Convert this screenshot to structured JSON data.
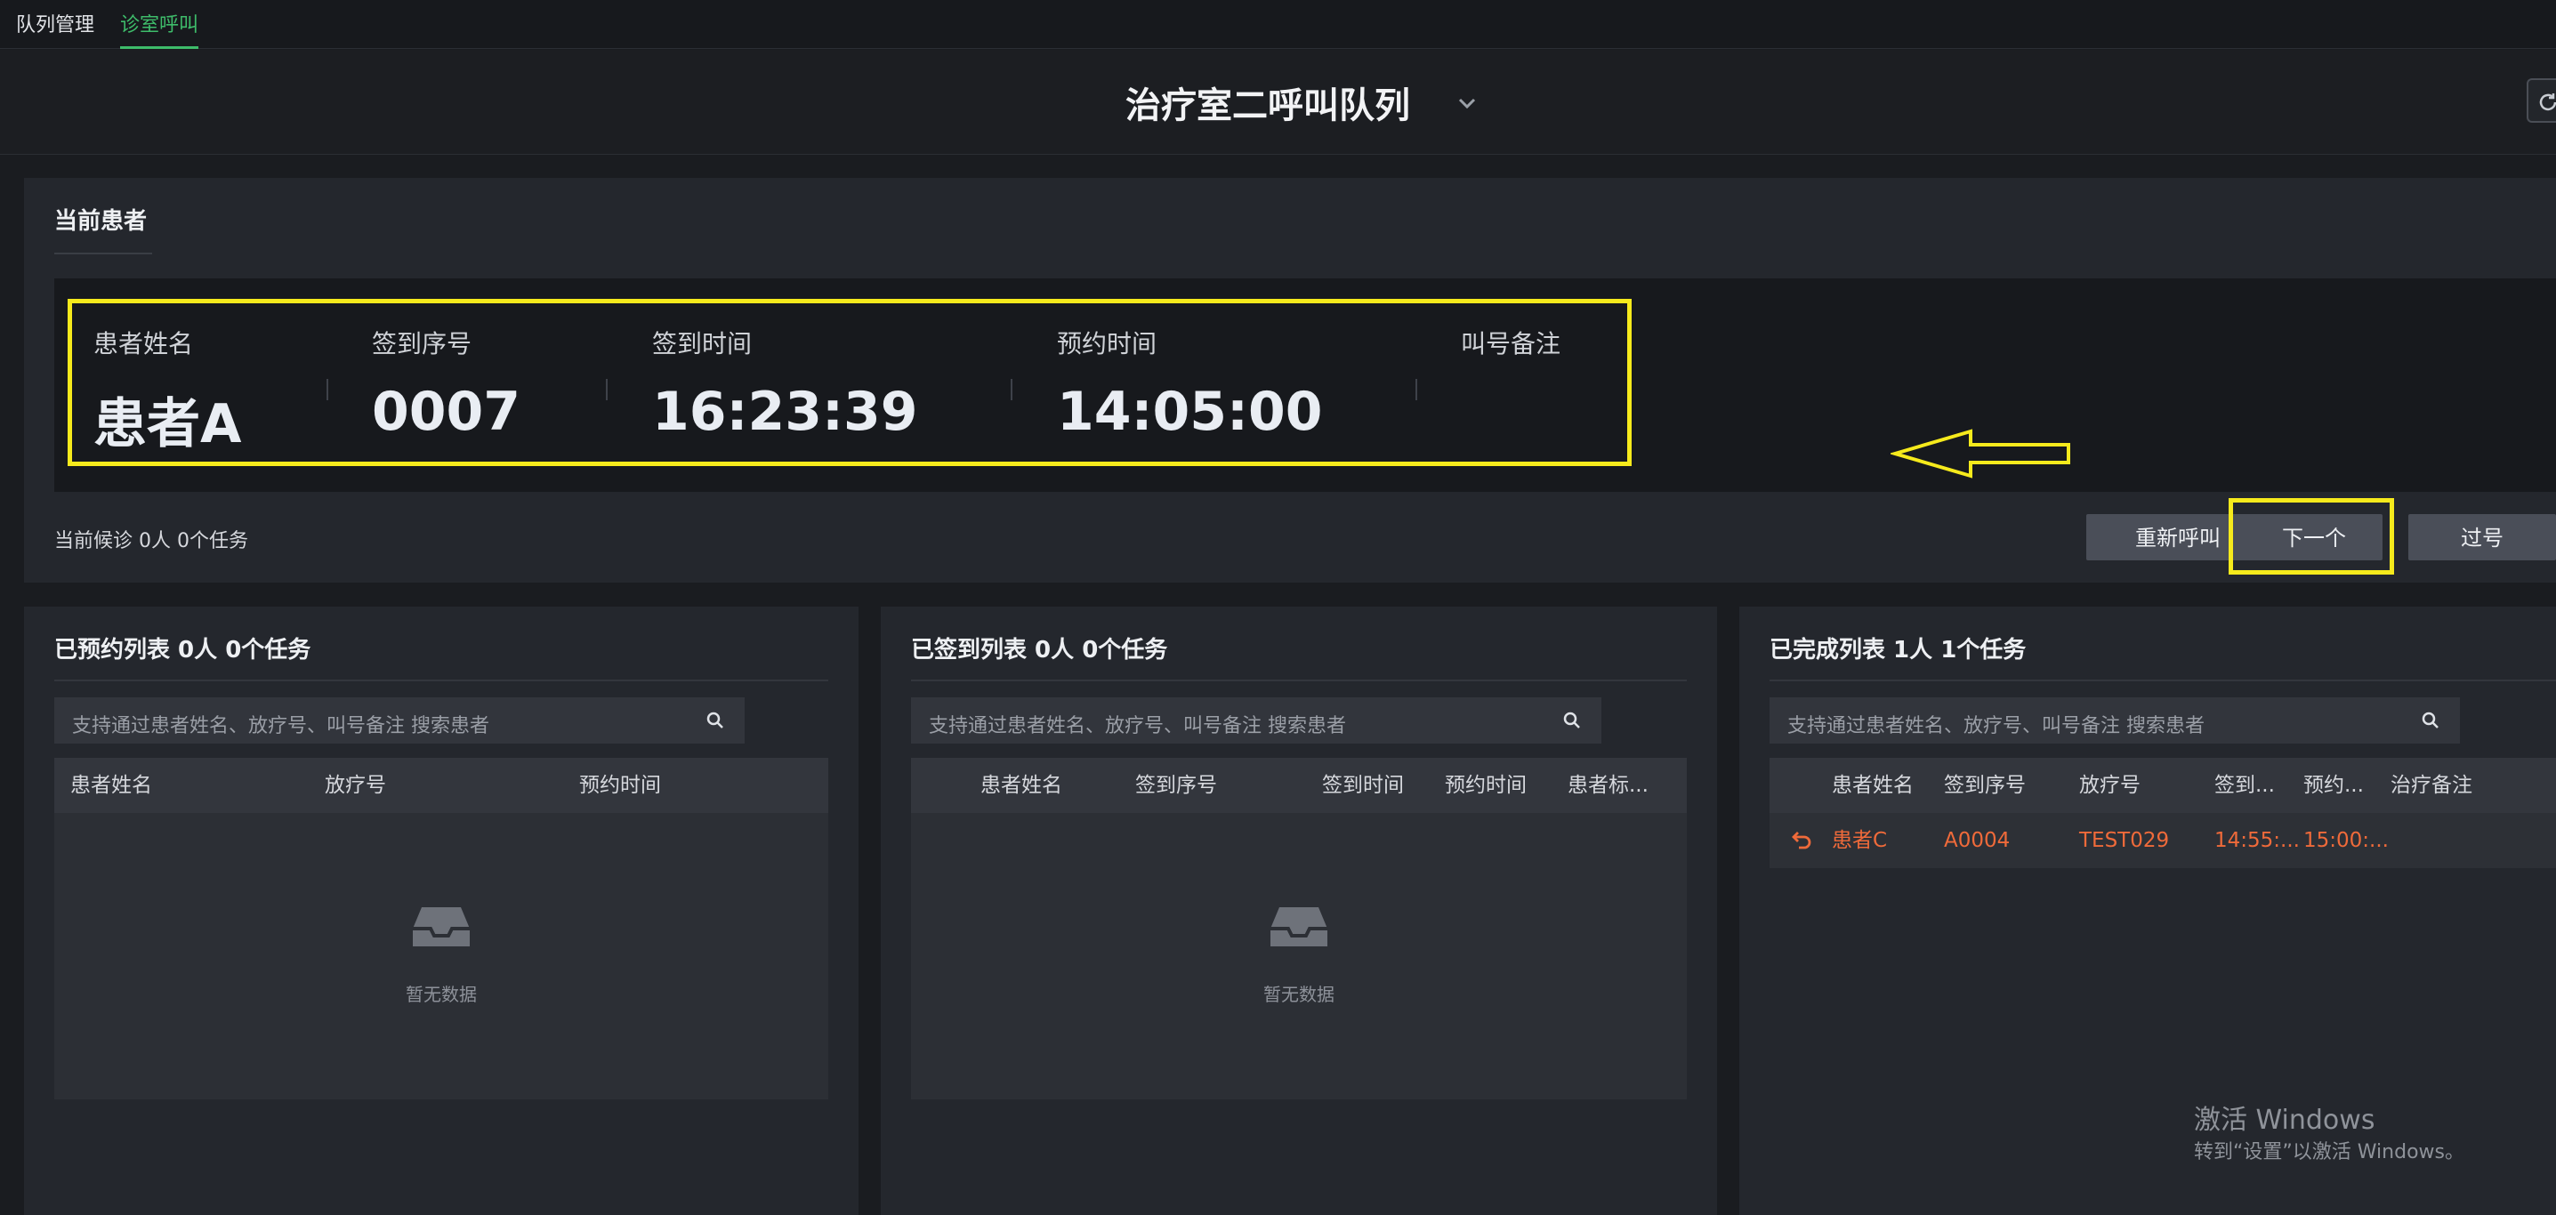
{
  "nav": {
    "tabs": [
      {
        "label": "队列管理"
      },
      {
        "label": "诊室呼叫"
      }
    ],
    "active_color": "#3ebc6a"
  },
  "header": {
    "title": "治疗室二呼叫队列"
  },
  "current_patient": {
    "title": "当前患者",
    "fields": [
      {
        "label": "患者姓名",
        "value": "患者A"
      },
      {
        "label": "签到序号",
        "value": "0007"
      },
      {
        "label": "签到时间",
        "value": "16:23:39"
      },
      {
        "label": "预约时间",
        "value": "14:05:00"
      },
      {
        "label": "叫号备注",
        "value": ""
      }
    ],
    "waiting_text": "当前候诊 0人 0个任务",
    "buttons": {
      "recall": "重新呼叫",
      "next": "下一个",
      "skip": "过号"
    }
  },
  "panels": {
    "reserved": {
      "title": "已预约列表 0人 0个任务",
      "search_placeholder": "支持通过患者姓名、放疗号、叫号备注 搜索患者",
      "columns": [
        "患者姓名",
        "放疗号",
        "预约时间"
      ],
      "empty_text": "暂无数据"
    },
    "checked_in": {
      "title": "已签到列表 0人 0个任务",
      "search_placeholder": "支持通过患者姓名、放疗号、叫号备注 搜索患者",
      "columns": [
        "患者姓名",
        "签到序号",
        "签到时间",
        "预约时间",
        "患者标..."
      ],
      "empty_text": "暂无数据"
    },
    "completed": {
      "title": "已完成列表 1人 1个任务",
      "search_placeholder": "支持通过患者姓名、放疗号、叫号备注 搜索患者",
      "columns": [
        "患者姓名",
        "签到序号",
        "放疗号",
        "签到...",
        "预约...",
        "治疗备注"
      ],
      "rows": [
        {
          "name": "患者C",
          "sign_no": "A0004",
          "rt_no": "TEST029",
          "sign_time": "14:55:...",
          "book_time": "15:00:..."
        }
      ]
    }
  },
  "watermark": {
    "line1": "激活 Windows",
    "line2": "转到“设置”以激活 Windows。"
  },
  "colors": {
    "highlight": "#f6ea1c",
    "row_text": "#ef6a3a",
    "background": "#1a1c20"
  }
}
